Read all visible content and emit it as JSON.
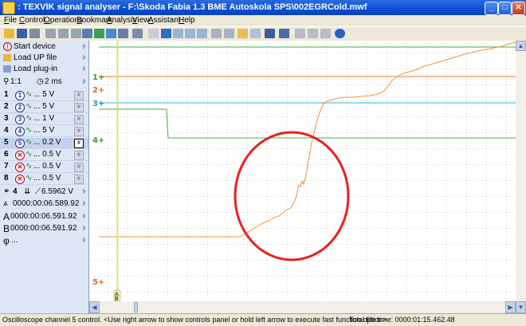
{
  "window": {
    "title": ": TEXVIK  signal analyser - F:\\Skoda Fabia 1.3 BME Autoskola SPS\\002EGRCold.mwf",
    "minimize": "_",
    "maximize": "□",
    "close": "✕"
  },
  "menu": [
    "File",
    "Control",
    "Operations",
    "Bookmark",
    "Analysis",
    "View",
    "Assistant",
    "Help"
  ],
  "panel": {
    "start_device": "Start device",
    "load_up": "Load UP file",
    "load_plugin": "Load plug-in",
    "zoom": "1:1",
    "timebase": "2 ms",
    "channels": [
      {
        "num": "1",
        "label": "... 5 V",
        "off": false
      },
      {
        "num": "2",
        "label": "... 5 V",
        "off": false
      },
      {
        "num": "3",
        "label": "... 1 V",
        "off": false
      },
      {
        "num": "4",
        "label": "... 5 V",
        "off": false
      },
      {
        "num": "5",
        "label": "... 0.2 V",
        "off": false
      },
      {
        "num": "6",
        "label": "... 0.5 V",
        "off": true
      },
      {
        "num": "7",
        "label": "... 0.5 V",
        "off": true
      },
      {
        "num": "8",
        "label": "... 0.5 V",
        "off": true
      }
    ],
    "cursor_channel": "4",
    "cursor_value": "6.5962 V",
    "delta_time": "0000:00:06.589.92",
    "cursor_a_label": "A",
    "cursor_a": "0000:00:06.591.92",
    "cursor_b_label": "B",
    "cursor_b": "0000:00:06.591.92",
    "phase_label": "φ",
    "phase_value": "..."
  },
  "plot": {
    "marker_labels": [
      {
        "text": "1+",
        "color": "#2e9e2e"
      },
      {
        "text": "2+",
        "color": "#e06a10"
      },
      {
        "text": "3+",
        "color": "#1aa6c8"
      },
      {
        "text": "4+",
        "color": "#2e9e2e"
      },
      {
        "text": "5+",
        "color": "#e06a10"
      }
    ],
    "cursor_tags": [
      "A",
      "B"
    ]
  },
  "status": {
    "message": "Oscilloscope channel 5 control. <Use right arrow to show controls panel or hold left arrow to execute fast function option>",
    "file_time": "Total file time: 0000:01:15.462.48"
  },
  "colors": {
    "green": "#2e9e2e",
    "orange": "#f0903a",
    "cyan": "#2ab8d8",
    "red_circle": "#e8201e",
    "cursor": "#d8d070"
  }
}
